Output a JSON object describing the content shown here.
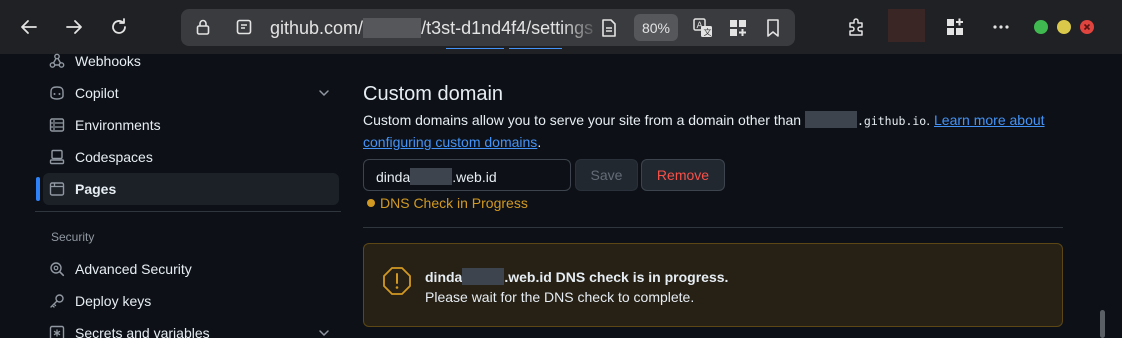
{
  "browser": {
    "url_start": "github.com/",
    "url_end": "/t3st-d1nd4f4/settings",
    "zoom": "80%"
  },
  "sidebar": {
    "items": [
      {
        "label": "Webhooks",
        "icon": "webhook-icon"
      },
      {
        "label": "Copilot",
        "icon": "copilot-icon"
      },
      {
        "label": "Environments",
        "icon": "server-icon"
      },
      {
        "label": "Codespaces",
        "icon": "codespaces-icon"
      },
      {
        "label": "Pages",
        "icon": "browser-icon",
        "active": true
      }
    ],
    "security_section": "Security",
    "security_items": [
      {
        "label": "Advanced Security",
        "icon": "shield-search-icon"
      },
      {
        "label": "Deploy keys",
        "icon": "key-icon"
      },
      {
        "label": "Secrets and variables",
        "icon": "asterisk-icon"
      }
    ]
  },
  "custom_domain": {
    "title": "Custom domain",
    "desc_before": "Custom domains allow you to serve your site from a domain other than ",
    "desc_code": ".github.io",
    "desc_after": ". ",
    "link_text": "Learn more about configuring custom domains",
    "desc_end": ".",
    "domain_prefix": "dinda",
    "domain_suffix": ".web.id",
    "save_label": "Save",
    "remove_label": "Remove",
    "dns_status": "DNS Check in Progress"
  },
  "notice": {
    "title_prefix": "dinda",
    "title_suffix": ".web.id DNS check is in progress.",
    "message": "Please wait for the DNS check to complete."
  },
  "colors": {
    "accent": "#2f81f7",
    "link": "#4493f8",
    "warning": "#d29922",
    "danger": "#f85149"
  }
}
